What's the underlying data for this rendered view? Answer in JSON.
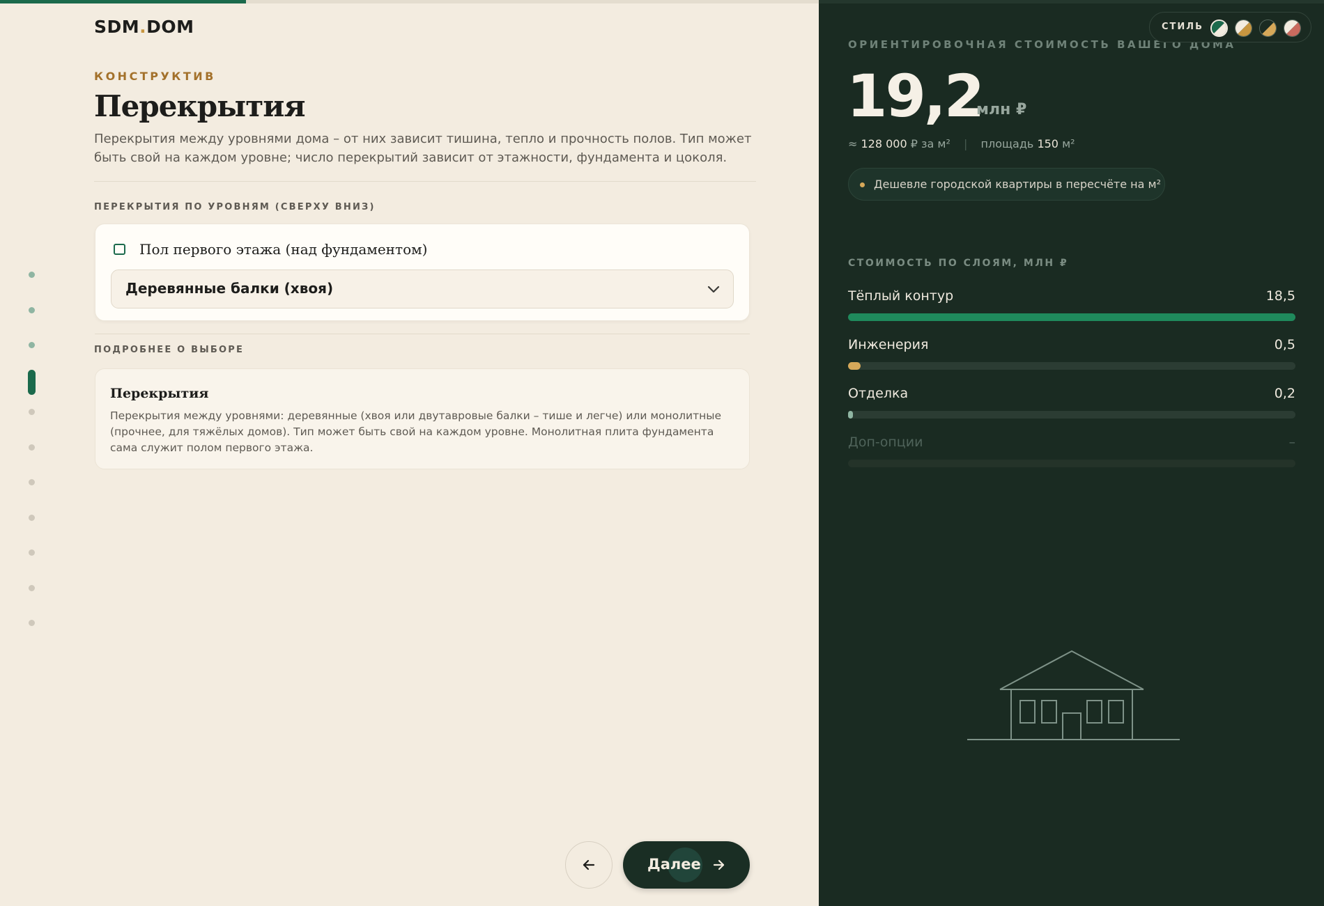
{
  "app": {
    "logo_text": "SDM",
    "logo_dot": ".",
    "logo_suffix": "DOM",
    "progress_fraction": 0.3
  },
  "steps": {
    "total": 11,
    "active_index": 3
  },
  "header": {
    "eyebrow": "КОНСТРУКТИВ",
    "title": "Перекрытия",
    "description": "Перекрытия между уровнями дома – от них зависит тишина, тепло и прочность полов. Тип может быть свой на каждом уровне; число перекрытий зависит от этажности, фундамента и цоколя."
  },
  "levels": {
    "section_label": "ПЕРЕКРЫТИЯ ПО УРОВНЯМ (СВЕРХУ ВНИЗ)",
    "items": [
      {
        "label": "Пол первого этажа (над фундаментом)",
        "selected_option": "Деревянные балки (хвоя)"
      }
    ]
  },
  "details": {
    "section_label": "ПОДРОБНЕЕ О ВЫБОРЕ",
    "title": "Перекрытия",
    "text": "Перекрытия между уровнями: деревянные (хвоя или двутавровые балки – тише и легче) или монолитные (прочнее, для тяжёлых домов). Тип может быть свой на каждом уровне. Монолитная плита фундамента сама служит полом первого этажа."
  },
  "nav": {
    "next_label": "Далее",
    "back_icon": "arrow-left-icon",
    "next_icon": "arrow-right-icon"
  },
  "style_switcher": {
    "label": "СТИЛЬ",
    "swatches": [
      {
        "a": "#1b6a4c",
        "b": "#f3ece0",
        "selected": true
      },
      {
        "a": "#f3ece0",
        "b": "#c89640",
        "selected": false
      },
      {
        "a": "#1a2b22",
        "b": "#d6a859",
        "selected": false
      },
      {
        "a": "#f3ece0",
        "b": "#c96a5e",
        "selected": false
      }
    ]
  },
  "cost": {
    "label": "ОРИЕНТИРОВОЧНАЯ СТОИМОСТЬ ВАШЕГО ДОМА",
    "value": "19,2",
    "unit": "млн ₽",
    "per_m2_prefix": "≈",
    "per_m2_value": "128 000",
    "per_m2_suffix": "₽ за м²",
    "area_prefix": "площадь",
    "area_value": "150",
    "area_suffix": "м²",
    "badge": "Дешевле городской квартиры в пересчёте на м²"
  },
  "layers": {
    "label": "СТОИМОСТЬ ПО СЛОЯМ, МЛН ₽",
    "items": [
      {
        "name": "Тёплый контур",
        "value": "18,5",
        "fraction": 1.0,
        "color": "#1f8a5c",
        "muted": false
      },
      {
        "name": "Инженерия",
        "value": "0,5",
        "fraction": 0.027,
        "color": "#d6a859",
        "muted": false
      },
      {
        "name": "Отделка",
        "value": "0,2",
        "fraction": 0.011,
        "color": "#8fb5a2",
        "muted": false
      },
      {
        "name": "Доп-опции",
        "value": "–",
        "fraction": 0,
        "color": "#2b3c33",
        "muted": true
      }
    ]
  },
  "colors": {
    "accent": "#1b6a4c",
    "gold": "#c89640",
    "dark_panel": "#1a2b22",
    "cream": "#f3ece0"
  }
}
